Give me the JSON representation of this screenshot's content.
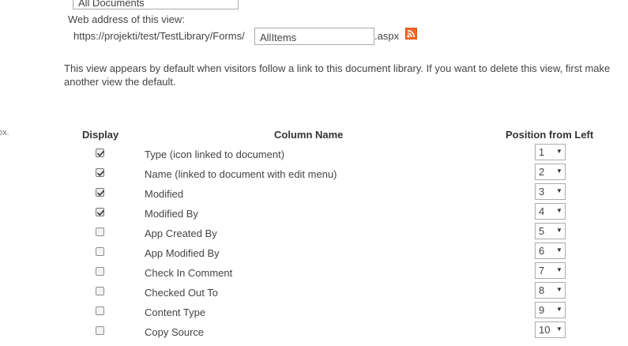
{
  "view_name": {
    "value": "All Documents"
  },
  "web_address": {
    "label": "Web address of this view:",
    "prefix": "https://projekti/test/TestLibrary/Forms/",
    "value": "AllItems",
    "suffix": ".aspx",
    "feed_icon": "rss-feed-icon"
  },
  "description": "This view appears by default when visitors follow a link to this document library. If you want to delete this view, first make another view the default.",
  "cut_off_text": "ox.",
  "columns_table": {
    "headers": {
      "display": "Display",
      "column_name": "Column Name",
      "position": "Position from Left"
    },
    "rows": [
      {
        "checked": true,
        "name": "Type (icon linked to document)",
        "position": "1"
      },
      {
        "checked": true,
        "name": "Name (linked to document with edit menu)",
        "position": "2"
      },
      {
        "checked": true,
        "name": "Modified",
        "position": "3"
      },
      {
        "checked": true,
        "name": "Modified By",
        "position": "4"
      },
      {
        "checked": false,
        "name": "App Created By",
        "position": "5"
      },
      {
        "checked": false,
        "name": "App Modified By",
        "position": "6"
      },
      {
        "checked": false,
        "name": "Check In Comment",
        "position": "7"
      },
      {
        "checked": false,
        "name": "Checked Out To",
        "position": "8"
      },
      {
        "checked": false,
        "name": "Content Type",
        "position": "9"
      },
      {
        "checked": false,
        "name": "Copy Source",
        "position": "10"
      }
    ]
  },
  "colors": {
    "rss_orange": "#f26522",
    "text": "#444444",
    "border": "#ababab"
  }
}
